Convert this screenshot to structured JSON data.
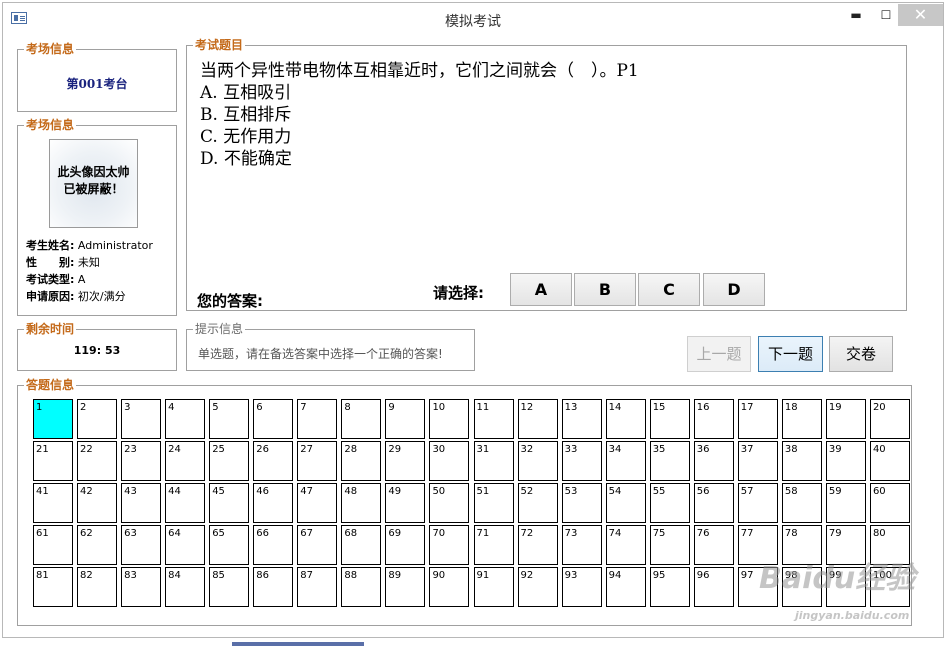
{
  "window": {
    "title": "模拟考试",
    "controls": {
      "minimize": "▬",
      "maximize": "☐",
      "close": "✕"
    }
  },
  "exam_room": {
    "group_label": "考场信息",
    "room": "第001考台"
  },
  "candidate": {
    "group_label": "考场信息",
    "avatar_text_line1": "此头像因太帅",
    "avatar_text_line2": "已被屏蔽！",
    "fields": [
      {
        "label": "考生姓名:",
        "value": "Administrator"
      },
      {
        "label": "性　　别:",
        "value": "未知"
      },
      {
        "label": "考试类型:",
        "value": "A"
      },
      {
        "label": "申请原因:",
        "value": "初次/满分"
      }
    ]
  },
  "timer": {
    "group_label": "剩余时间",
    "remaining": "119: 53"
  },
  "question": {
    "group_label": "考试题目",
    "stem": "当两个异性带电物体互相靠近时，它们之间就会（　）。P1",
    "options": [
      "A. 互相吸引",
      "B. 互相排斥",
      "C. 无作用力",
      "D. 不能确定"
    ],
    "your_answer_label": "您的答案:",
    "your_answer_value": "",
    "choose_label": "请选择:",
    "answer_buttons": [
      "A",
      "B",
      "C",
      "D"
    ]
  },
  "hint": {
    "group_label": "提示信息",
    "text": "单选题，请在备选答案中选择一个正确的答案!"
  },
  "nav": {
    "prev": "上一题",
    "next": "下一题",
    "submit": "交卷",
    "prev_enabled": false
  },
  "answer_sheet": {
    "group_label": "答题信息",
    "current": 1,
    "numbers": [
      "1",
      "2",
      "3",
      "4",
      "5",
      "6",
      "7",
      "8",
      "9",
      "10",
      "11",
      "12",
      "13",
      "14",
      "15",
      "16",
      "17",
      "18",
      "19",
      "20",
      "21",
      "22",
      "23",
      "24",
      "25",
      "26",
      "27",
      "28",
      "29",
      "30",
      "31",
      "32",
      "33",
      "34",
      "35",
      "36",
      "37",
      "38",
      "39",
      "40",
      "41",
      "42",
      "43",
      "44",
      "45",
      "46",
      "47",
      "48",
      "49",
      "50",
      "51",
      "52",
      "53",
      "54",
      "55",
      "56",
      "57",
      "58",
      "59",
      "60",
      "61",
      "62",
      "63",
      "64",
      "65",
      "66",
      "67",
      "68",
      "69",
      "70",
      "71",
      "72",
      "73",
      "74",
      "75",
      "76",
      "77",
      "78",
      "79",
      "80",
      "81",
      "82",
      "83",
      "84",
      "85",
      "86",
      "87",
      "88",
      "89",
      "90",
      "91",
      "92",
      "93",
      "94",
      "95",
      "96",
      "97",
      "98",
      "99",
      "100"
    ],
    "current_color": "#00ffff"
  },
  "watermark": {
    "logo": "Baidu经验",
    "url": "jingyan.baidu.com"
  }
}
